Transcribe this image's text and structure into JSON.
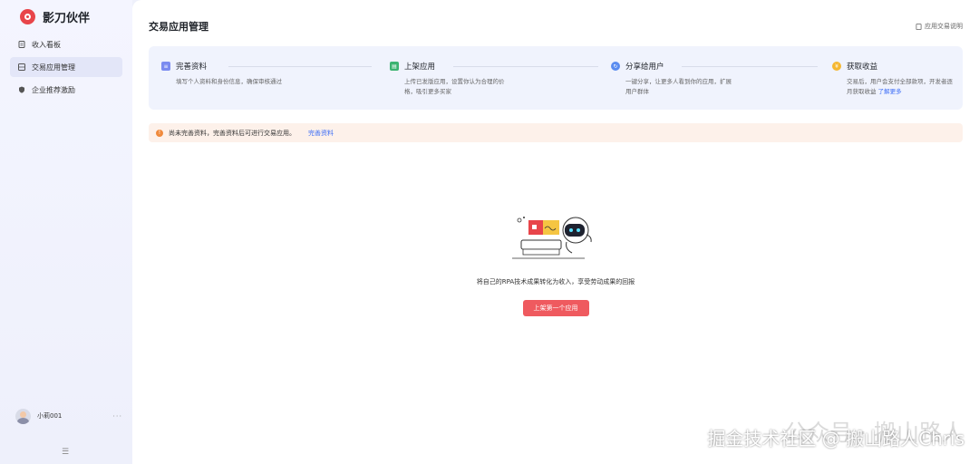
{
  "brand": {
    "name": "影刀伙伴"
  },
  "sidebar": {
    "items": [
      {
        "label": "收入看板",
        "icon": "document-icon"
      },
      {
        "label": "交易应用管理",
        "icon": "grid-icon"
      },
      {
        "label": "企业推荐激励",
        "icon": "shield-icon"
      }
    ],
    "active_index": 1,
    "user": {
      "name": "小莉001",
      "more": "···"
    },
    "collapse": "☰"
  },
  "header": {
    "title": "交易应用管理",
    "help_label": "应用交易说明"
  },
  "steps": [
    {
      "title": "完善资料",
      "desc": "填写个人资料和身份信息，确保审核通过",
      "icon": "document-icon",
      "color": "#7b8cf0"
    },
    {
      "title": "上架应用",
      "desc": "上传已发版应用，设置你认为合理的价格，吸引更多买家",
      "icon": "store-icon",
      "color": "#3cb371"
    },
    {
      "title": "分享给用户",
      "desc": "一键分享，让更多人看到你的应用，扩展用户群体",
      "icon": "share-icon",
      "color": "#5a8cf0"
    },
    {
      "title": "获取收益",
      "desc": "交易后，用户会支付全部款项，开发者逐月获取收益",
      "link": "了解更多",
      "icon": "coin-icon",
      "color": "#f5b731"
    }
  ],
  "notice": {
    "text": "尚未完善资料，完善资料后可进行交易应用。",
    "link": "完善资料"
  },
  "empty": {
    "text": "将自己的RPA技术成果转化为收入，享受劳动成果的回报",
    "button": "上架第一个应用"
  },
  "overlay": {
    "watermark": "公众号 · 搬山路人",
    "caption": "掘金技术社区 @ 搬山路人Chris"
  },
  "colors": {
    "accent": "#ef5a5f",
    "link": "#3b6cf6",
    "notice_bg": "#fdf1ea"
  }
}
